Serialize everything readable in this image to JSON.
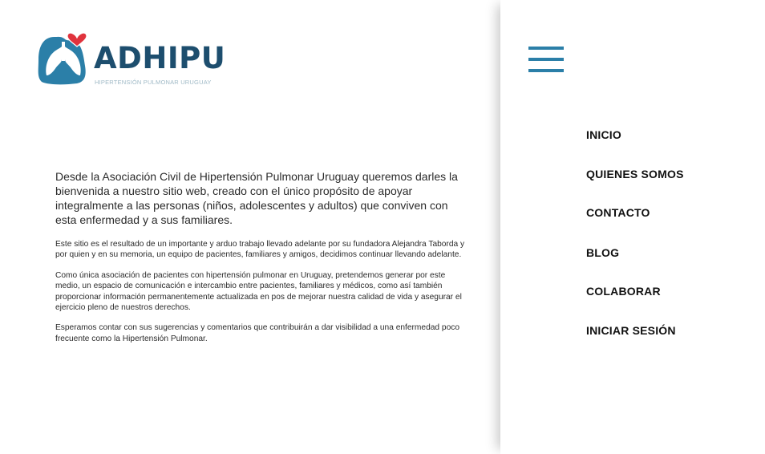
{
  "brand": {
    "name": "ADHIPU",
    "tagline": "HIPERTENSIÓN PULMONAR URUGUAY",
    "colors": {
      "primary": "#1d4e6e",
      "mark": "#2b7fa8",
      "heart": "#e0333d"
    }
  },
  "main": {
    "lead": "Desde la Asociación Civil de Hipertensión Pulmonar Uruguay queremos darles  la bienvenida a nuestro sitio web, creado con el único propósito de apoyar integralmente a las personas (niños, adolescentes y adultos) que conviven con esta enfermedad y a sus familiares.",
    "paragraphs": [
      "Este sitio es el resultado de un importante y arduo trabajo  llevado adelante por su fundadora Alejandra Taborda y por quien y en su memoria, un equipo de pacientes, familiares y amigos, decidimos continuar llevando adelante.",
      "Como única asociación de pacientes con hipertensión pulmonar en Uruguay, pretendemos generar por este medio, un espacio de comunicación e intercambio entre pacientes, familiares y médicos,  como así también proporcionar información permanentemente actualizada  en pos de mejorar nuestra calidad de vida y asegurar el ejercicio pleno de nuestros derechos.",
      "Esperamos contar con sus sugerencias y comentarios que contribuirán a dar visibilidad a una enfermedad poco frecuente como la Hipertensión Pulmonar."
    ]
  },
  "menu": {
    "toggle_icon": "hamburger-menu-icon",
    "items": [
      {
        "label": "INICIO"
      },
      {
        "label": "QUIENES SOMOS"
      },
      {
        "label": "CONTACTO"
      },
      {
        "label": "BLOG"
      },
      {
        "label": "COLABORAR"
      },
      {
        "label": "INICIAR SESIÓN"
      }
    ]
  }
}
